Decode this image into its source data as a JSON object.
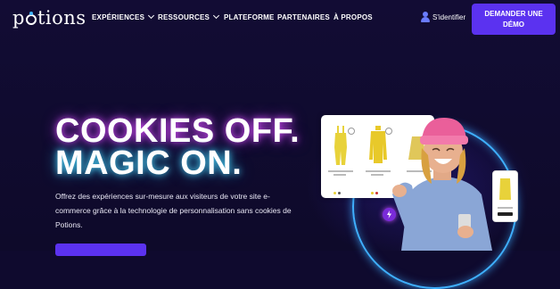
{
  "brand": {
    "logo_text": "potions"
  },
  "nav": {
    "items": [
      {
        "label": "EXPÉRIENCES",
        "has_dropdown": true
      },
      {
        "label": "RESSOURCES",
        "has_dropdown": true
      },
      {
        "label": "PLATEFORME",
        "has_dropdown": false
      },
      {
        "label": "PARTENAIRES",
        "has_dropdown": false
      },
      {
        "label": "À PROPOS",
        "has_dropdown": false
      }
    ],
    "login_label": "S'identifier",
    "demo_button": "DEMANDER UNE DÉMO"
  },
  "hero": {
    "title_line1": "COOKIES OFF.",
    "title_line2": "MAGIC ON.",
    "description": "Offrez des expériences sur-mesure aux visiteurs de votre site e-commerce grâce à la technologie de personnalisation sans cookies de Potions."
  },
  "colors": {
    "background": "#0f0a2e",
    "accent": "#5b32f0",
    "glow_pink": "#dc50ff",
    "glow_cyan": "#50dcff",
    "ring": "#3fb0ff",
    "product_yellow": "#e8d23a"
  },
  "icons": {
    "user": "user-icon",
    "chevron": "chevron-down-icon",
    "bolt": "bolt-icon"
  }
}
